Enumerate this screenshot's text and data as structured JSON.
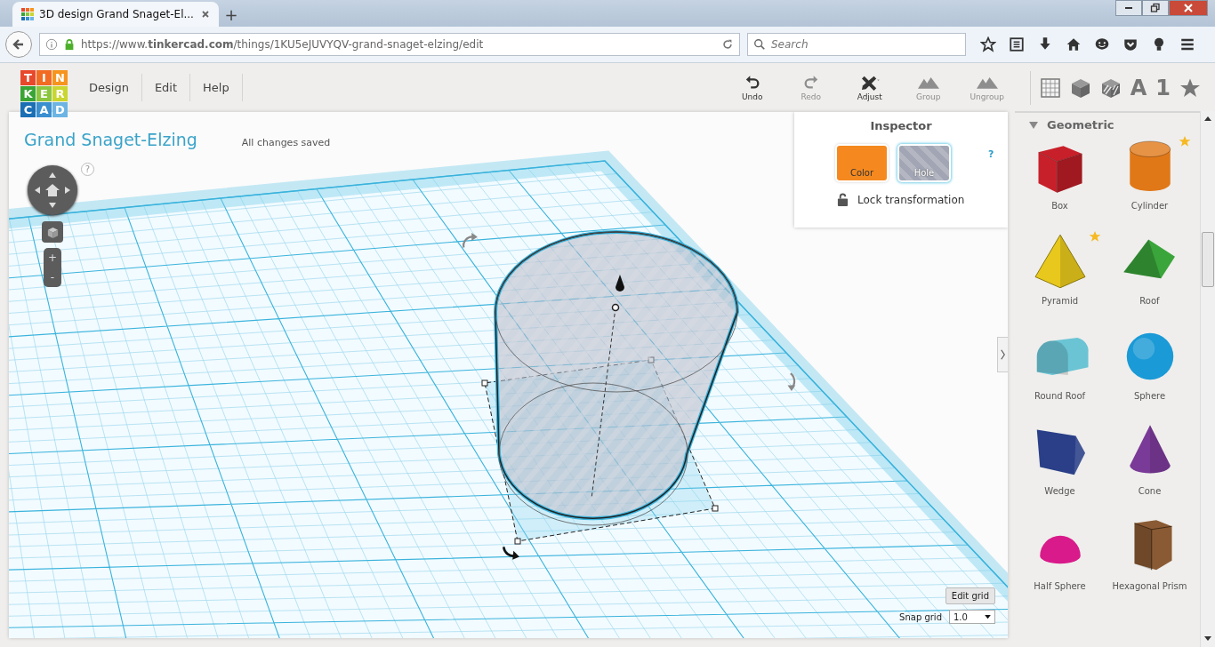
{
  "browser": {
    "tab_title": "3D design Grand Snaget-El...",
    "new_tab": "+",
    "url": "https://www.**tinkercad.com**/things/1KU5eJUVYQV-grand-snaget-elzing/edit",
    "search": {
      "placeholder": "Search"
    }
  },
  "logo": [
    {
      "letter": "T",
      "color": "#e8492b"
    },
    {
      "letter": "I",
      "color": "#f26b22"
    },
    {
      "letter": "N",
      "color": "#f7941d"
    },
    {
      "letter": "K",
      "color": "#3aa535"
    },
    {
      "letter": "E",
      "color": "#8cc63f"
    },
    {
      "letter": "R",
      "color": "#c9d62f"
    },
    {
      "letter": "C",
      "color": "#1a6fb5"
    },
    {
      "letter": "A",
      "color": "#3a8fd0"
    },
    {
      "letter": "D",
      "color": "#6cb4e3"
    }
  ],
  "menu": [
    "Design",
    "Edit",
    "Help"
  ],
  "toolbar": [
    {
      "kind": "undo",
      "label": "Undo",
      "disabled": false
    },
    {
      "kind": "redo",
      "label": "Redo",
      "disabled": true
    },
    {
      "kind": "adjust",
      "label": "Adjust",
      "disabled": false
    },
    {
      "kind": "group",
      "label": "Group",
      "disabled": true
    },
    {
      "kind": "ungroup",
      "label": "Ungroup",
      "disabled": true
    }
  ],
  "library_tabs": [
    {
      "kind": "grid"
    },
    {
      "kind": "cube"
    },
    {
      "kind": "hole-cube"
    },
    {
      "kind": "text",
      "label": "A"
    },
    {
      "kind": "text",
      "label": "1"
    },
    {
      "kind": "star"
    }
  ],
  "design": {
    "title": "Grand Snaget-Elzing",
    "status": "All changes saved",
    "help": "?"
  },
  "view_controls": {
    "zoom_in": "+",
    "zoom_out": "-"
  },
  "inspector": {
    "title": "Inspector",
    "help": "?",
    "modes": [
      {
        "label": "Color",
        "kind": "solid",
        "selected": false
      },
      {
        "label": "Hole",
        "kind": "hole",
        "selected": true
      }
    ],
    "lock": "Lock transformation"
  },
  "grid_controls": {
    "edit_grid": "Edit grid",
    "snap_label": "Snap grid",
    "snap_value": "1.0"
  },
  "library": {
    "category": "Geometric",
    "expanded": true,
    "shapes": [
      {
        "name": "Box",
        "kind": "box",
        "color": "#c8202a",
        "starred": false
      },
      {
        "name": "Cylinder",
        "kind": "cylinder",
        "color": "#e07818",
        "starred": true
      },
      {
        "name": "Pyramid",
        "kind": "pyramid",
        "color": "#e8c81c",
        "starred": true
      },
      {
        "name": "Roof",
        "kind": "roof",
        "color": "#3aa53a",
        "starred": false
      },
      {
        "name": "Round Roof",
        "kind": "round-roof",
        "color": "#6ac4d4",
        "starred": false
      },
      {
        "name": "Sphere",
        "kind": "sphere",
        "color": "#1a9ad6",
        "starred": false
      },
      {
        "name": "Wedge",
        "kind": "wedge",
        "color": "#2a3f88",
        "starred": false
      },
      {
        "name": "Cone",
        "kind": "cone",
        "color": "#7a3a98",
        "starred": false
      },
      {
        "name": "Half Sphere",
        "kind": "half-sphere",
        "color": "#d81a8a",
        "starred": false
      },
      {
        "name": "Hexagonal Prism",
        "kind": "hex-prism",
        "color": "#8a5a34",
        "starred": false
      }
    ]
  }
}
